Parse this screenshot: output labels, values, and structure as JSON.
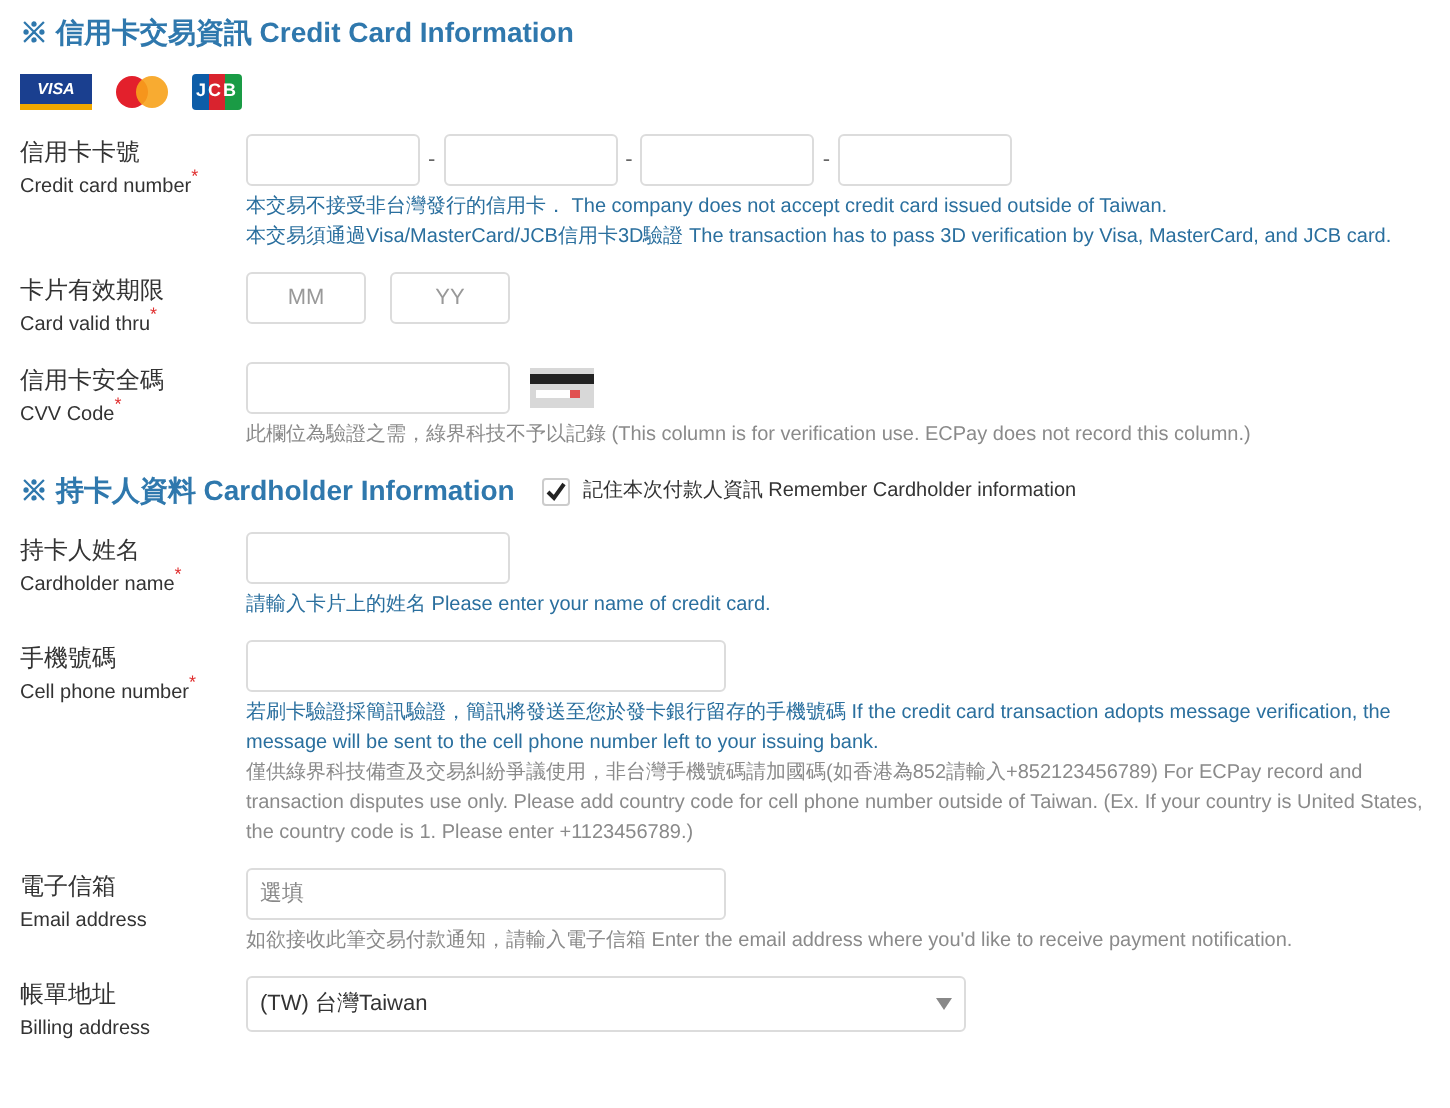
{
  "sections": [
    {
      "title": "※ 信用卡交易資訊 Credit Card Information",
      "card_logos": [
        {
          "kind": "visa",
          "label": "VISA"
        },
        {
          "kind": "mastercard"
        },
        {
          "kind": "jcb",
          "label": "JCB"
        }
      ],
      "fields": [
        {
          "kind": "card_number",
          "label": "信用卡卡號",
          "sublabel": "Credit card number",
          "required_mark": "*",
          "separator": "-",
          "notes": [
            {
              "kind": "info",
              "text": "本交易不接受非台灣發行的信用卡． The company does not accept credit card issued outside of Taiwan."
            },
            {
              "kind": "info",
              "text": "本交易須通過Visa/MasterCard/JCB信用卡3D驗證 The transaction has to pass 3D verification by Visa, MasterCard, and JCB card."
            }
          ]
        },
        {
          "kind": "expiry",
          "label": "卡片有效期限",
          "sublabel": "Card valid thru",
          "required_mark": "*",
          "placeholders": [
            "MM",
            "YY"
          ]
        },
        {
          "kind": "cvv",
          "label": "信用卡安全碼",
          "sublabel": "CVV Code",
          "required_mark": "*",
          "notes": [
            {
              "kind": "note",
              "text": "此欄位為驗證之需，綠界科技不予以記錄 (This column is for verification use. ECPay does not record this column.)"
            }
          ]
        }
      ]
    },
    {
      "title": "※ 持卡人資料 Cardholder Information",
      "remember": {
        "label": "記住本次付款人資訊 Remember Cardholder information",
        "checked": true
      },
      "fields": [
        {
          "kind": "short",
          "label": "持卡人姓名",
          "sublabel": "Cardholder name",
          "required_mark": "*",
          "notes": [
            {
              "kind": "info",
              "text": "請輸入卡片上的姓名 Please enter your name of credit card."
            }
          ]
        },
        {
          "kind": "long",
          "label": "手機號碼",
          "sublabel": "Cell phone number",
          "required_mark": "*",
          "notes": [
            {
              "kind": "info",
              "text": "若刷卡驗證採簡訊驗證，簡訊將發送至您於發卡銀行留存的手機號碼 If the credit card transaction adopts message verification, the message will be sent to the cell phone number left to your issuing bank."
            },
            {
              "kind": "note",
              "text": "僅供綠界科技備查及交易糾紛爭議使用，非台灣手機號碼請加國碼(如香港為852請輸入+852123456789) For ECPay record and transaction disputes use only. Please add country code for cell phone number outside of Taiwan. (Ex. If your country is United States, the country code is 1. Please enter +1123456789.)"
            }
          ]
        },
        {
          "kind": "long",
          "label": "電子信箱",
          "sublabel": "Email address",
          "placeholder": "選填",
          "notes": [
            {
              "kind": "note",
              "text": "如欲接收此筆交易付款通知，請輸入電子信箱 Enter the email address where you'd like to receive payment notification."
            }
          ]
        },
        {
          "kind": "select",
          "label": "帳單地址",
          "sublabel": "Billing address",
          "value": "(TW) 台灣Taiwan"
        }
      ]
    }
  ]
}
